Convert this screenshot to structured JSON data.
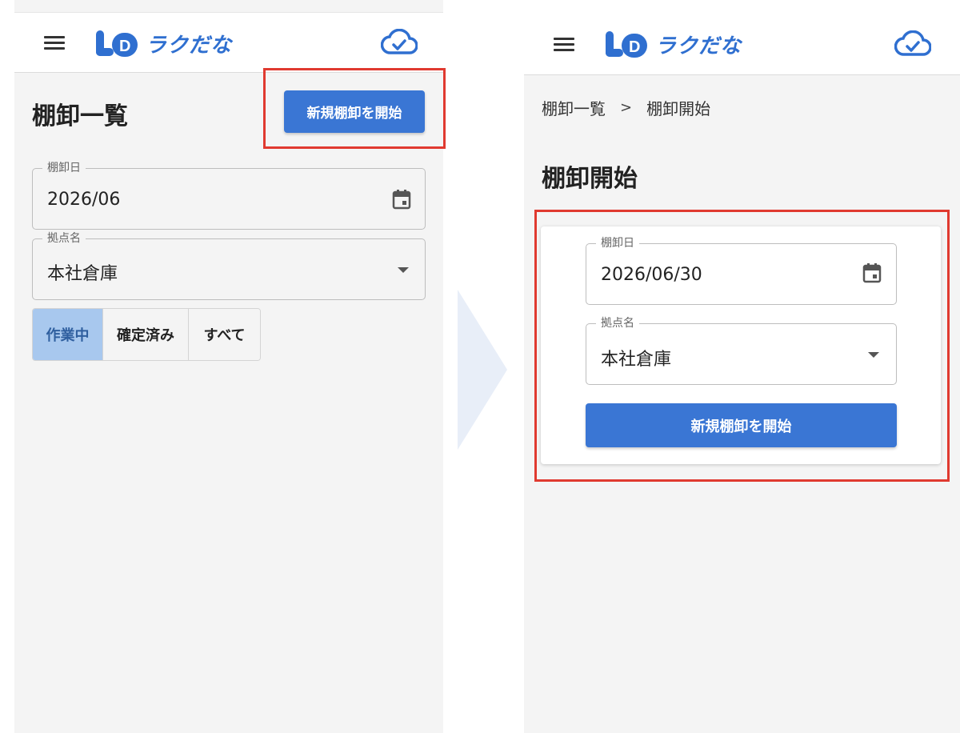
{
  "app": {
    "brand_name": "ラクだな",
    "brand_color": "#2f6fd0",
    "accent_color": "#3a76d4",
    "highlight_color": "#e03a30"
  },
  "left_screen": {
    "page_title": "棚卸一覧",
    "new_button_label": "新規棚卸を開始",
    "date_field": {
      "label": "棚卸日",
      "value": "2026/06",
      "icon": "calendar-icon"
    },
    "location_field": {
      "label": "拠点名",
      "value": "本社倉庫",
      "icon": "dropdown-caret-icon"
    },
    "status_filter": {
      "options": [
        {
          "label": "作業中",
          "selected": true
        },
        {
          "label": "確定済み",
          "selected": false
        },
        {
          "label": "すべて",
          "selected": false
        }
      ]
    }
  },
  "right_screen": {
    "breadcrumb": {
      "items": [
        "棚卸一覧",
        "棚卸開始"
      ],
      "separator": ">"
    },
    "page_title": "棚卸開始",
    "date_field": {
      "label": "棚卸日",
      "value": "2026/06/30",
      "icon": "calendar-icon"
    },
    "location_field": {
      "label": "拠点名",
      "value": "本社倉庫",
      "icon": "dropdown-caret-icon"
    },
    "start_button_label": "新規棚卸を開始"
  },
  "icons": {
    "menu": "hamburger-menu-icon",
    "sync": "cloud-check-icon",
    "logo": "logo-mark-icon"
  }
}
